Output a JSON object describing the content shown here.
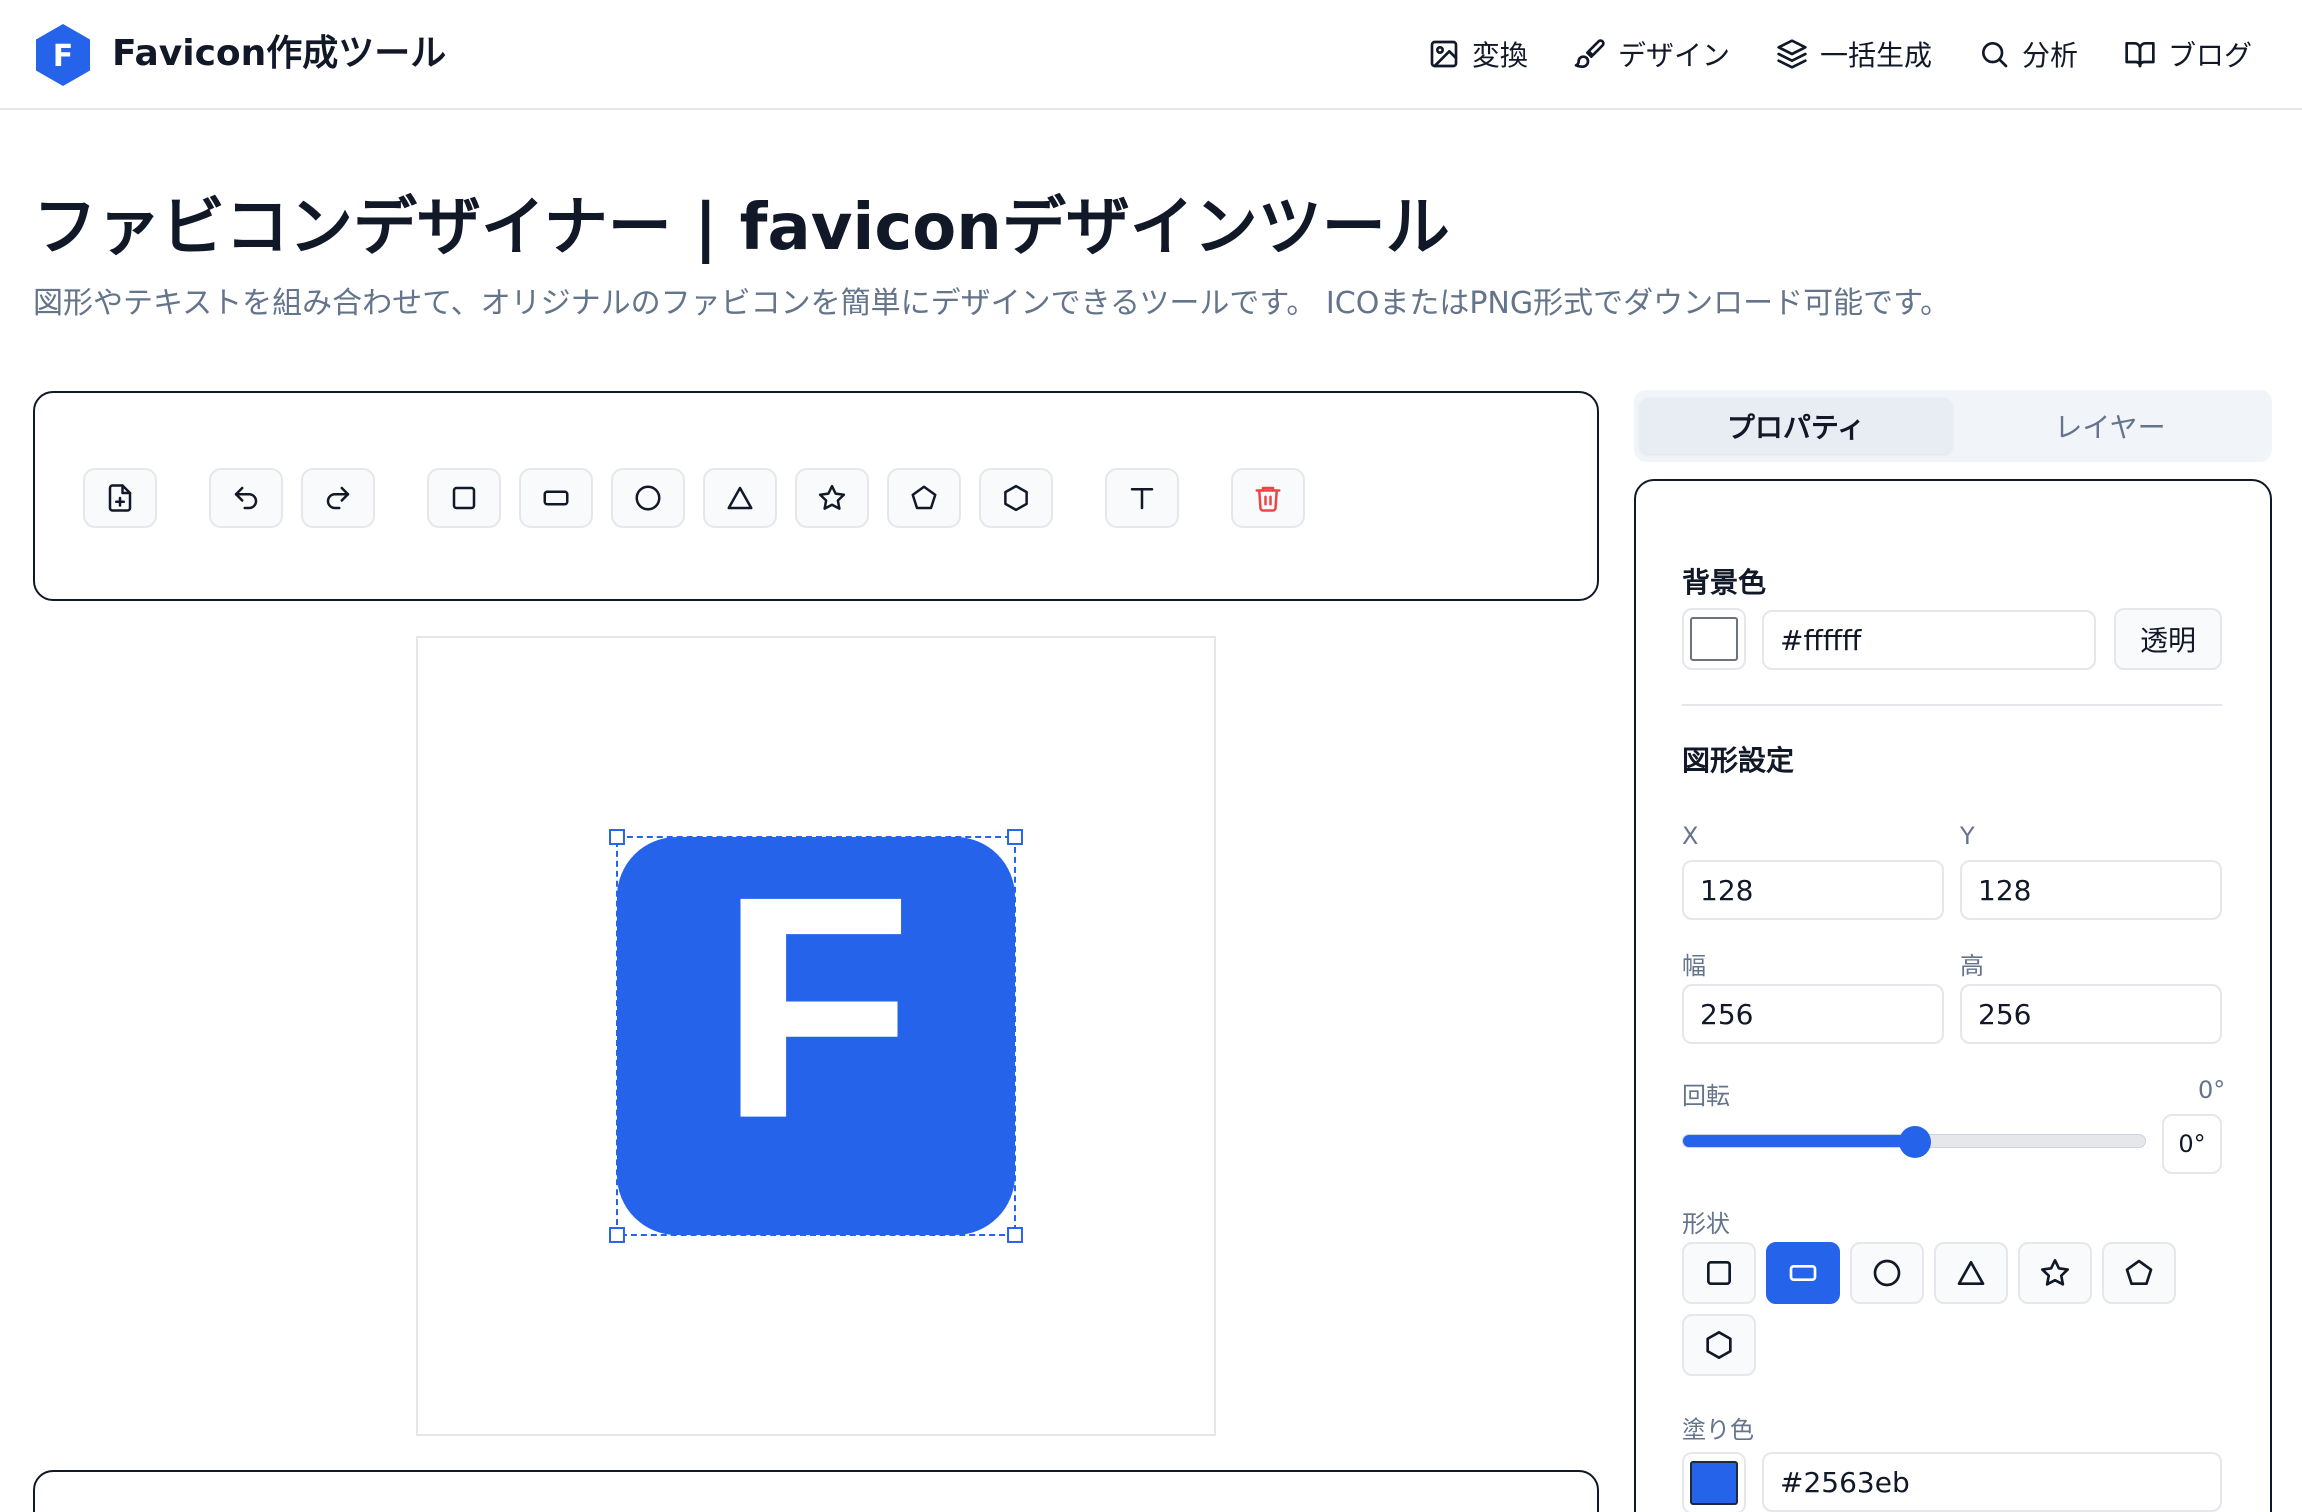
{
  "header": {
    "brand": "Favicon作成ツール",
    "logo_letter": "F",
    "nav": [
      {
        "label": "変換",
        "icon": "image-icon"
      },
      {
        "label": "デザイン",
        "icon": "paintbrush-icon"
      },
      {
        "label": "一括生成",
        "icon": "layers-icon"
      },
      {
        "label": "分析",
        "icon": "search-icon"
      },
      {
        "label": "ブログ",
        "icon": "book-open-icon"
      }
    ]
  },
  "hero": {
    "title": "ファビコンデザイナー | faviconデザインツール",
    "subtitle": "図形やテキストを組み合わせて、オリジナルのファビコンを簡単にデザインできるツールです。 ICOまたはPNG形式でダウンロード可能です。"
  },
  "toolbar": {
    "buttons": [
      "new-file-icon",
      "undo-icon",
      "redo-icon",
      "square-icon",
      "rectangle-icon",
      "circle-icon",
      "triangle-icon",
      "star-icon",
      "pentagon-icon",
      "hexagon-icon",
      "text-icon",
      "trash-icon"
    ]
  },
  "canvas": {
    "letter": "F",
    "shape_color": "#2563eb",
    "letter_color": "#ffffff",
    "selection_color": "#2563eb"
  },
  "tabs": {
    "properties": "プロパティ",
    "layers": "レイヤー"
  },
  "properties": {
    "background": {
      "title": "背景色",
      "value": "#ffffff",
      "transparent_label": "透明"
    },
    "shape_settings": {
      "title": "図形設定",
      "x_label": "X",
      "x": "128",
      "y_label": "Y",
      "y": "128",
      "w_label": "幅",
      "w": "256",
      "h_label": "高",
      "h": "256"
    },
    "rotation": {
      "label": "回転",
      "display": "0°",
      "value_label": "0°",
      "slider_fraction": 0.5
    },
    "shape": {
      "label": "形状",
      "options": [
        "square-icon",
        "rounded-rectangle-icon",
        "circle-icon",
        "triangle-icon",
        "star-icon",
        "pentagon-icon",
        "hexagon-icon"
      ],
      "selected": "rounded-rectangle-icon"
    },
    "fill": {
      "label": "塗り色",
      "value": "#2563eb"
    }
  }
}
